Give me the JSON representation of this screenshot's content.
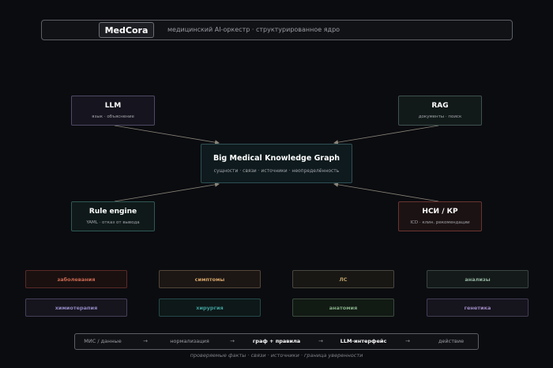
{
  "header": {
    "brand": "MedCora",
    "tagline": "медицинский AI-оркестр · структурированное ядро"
  },
  "nodes": {
    "llm": {
      "title": "LLM",
      "subtitle": "язык · объяснение"
    },
    "rag": {
      "title": "RAG",
      "subtitle": "документы · поиск"
    },
    "core": {
      "title": "Big Medical Knowledge Graph",
      "subtitle": "сущности · связи · источники · неопределённость"
    },
    "rule": {
      "title": "Rule engine",
      "subtitle": "YAML · отказ от вывода"
    },
    "nsi": {
      "title": "НСИ / КР",
      "subtitle": "ICD · клин. рекомендации"
    }
  },
  "categories": [
    "заболевания",
    "симптомы",
    "ЛС",
    "анализы",
    "химиотерапия",
    "хирургия",
    "анатомия",
    "генетика"
  ],
  "pipeline": {
    "steps": [
      "МИС / данные",
      "нормализация",
      "граф + правила",
      "LLM-интерфейс",
      "действие"
    ],
    "arrow": "→"
  },
  "footer": "проверяемые факты · связи · источники · граница уверенности",
  "colors": {
    "background": "#0b0c10",
    "edge": "#8a8478"
  }
}
